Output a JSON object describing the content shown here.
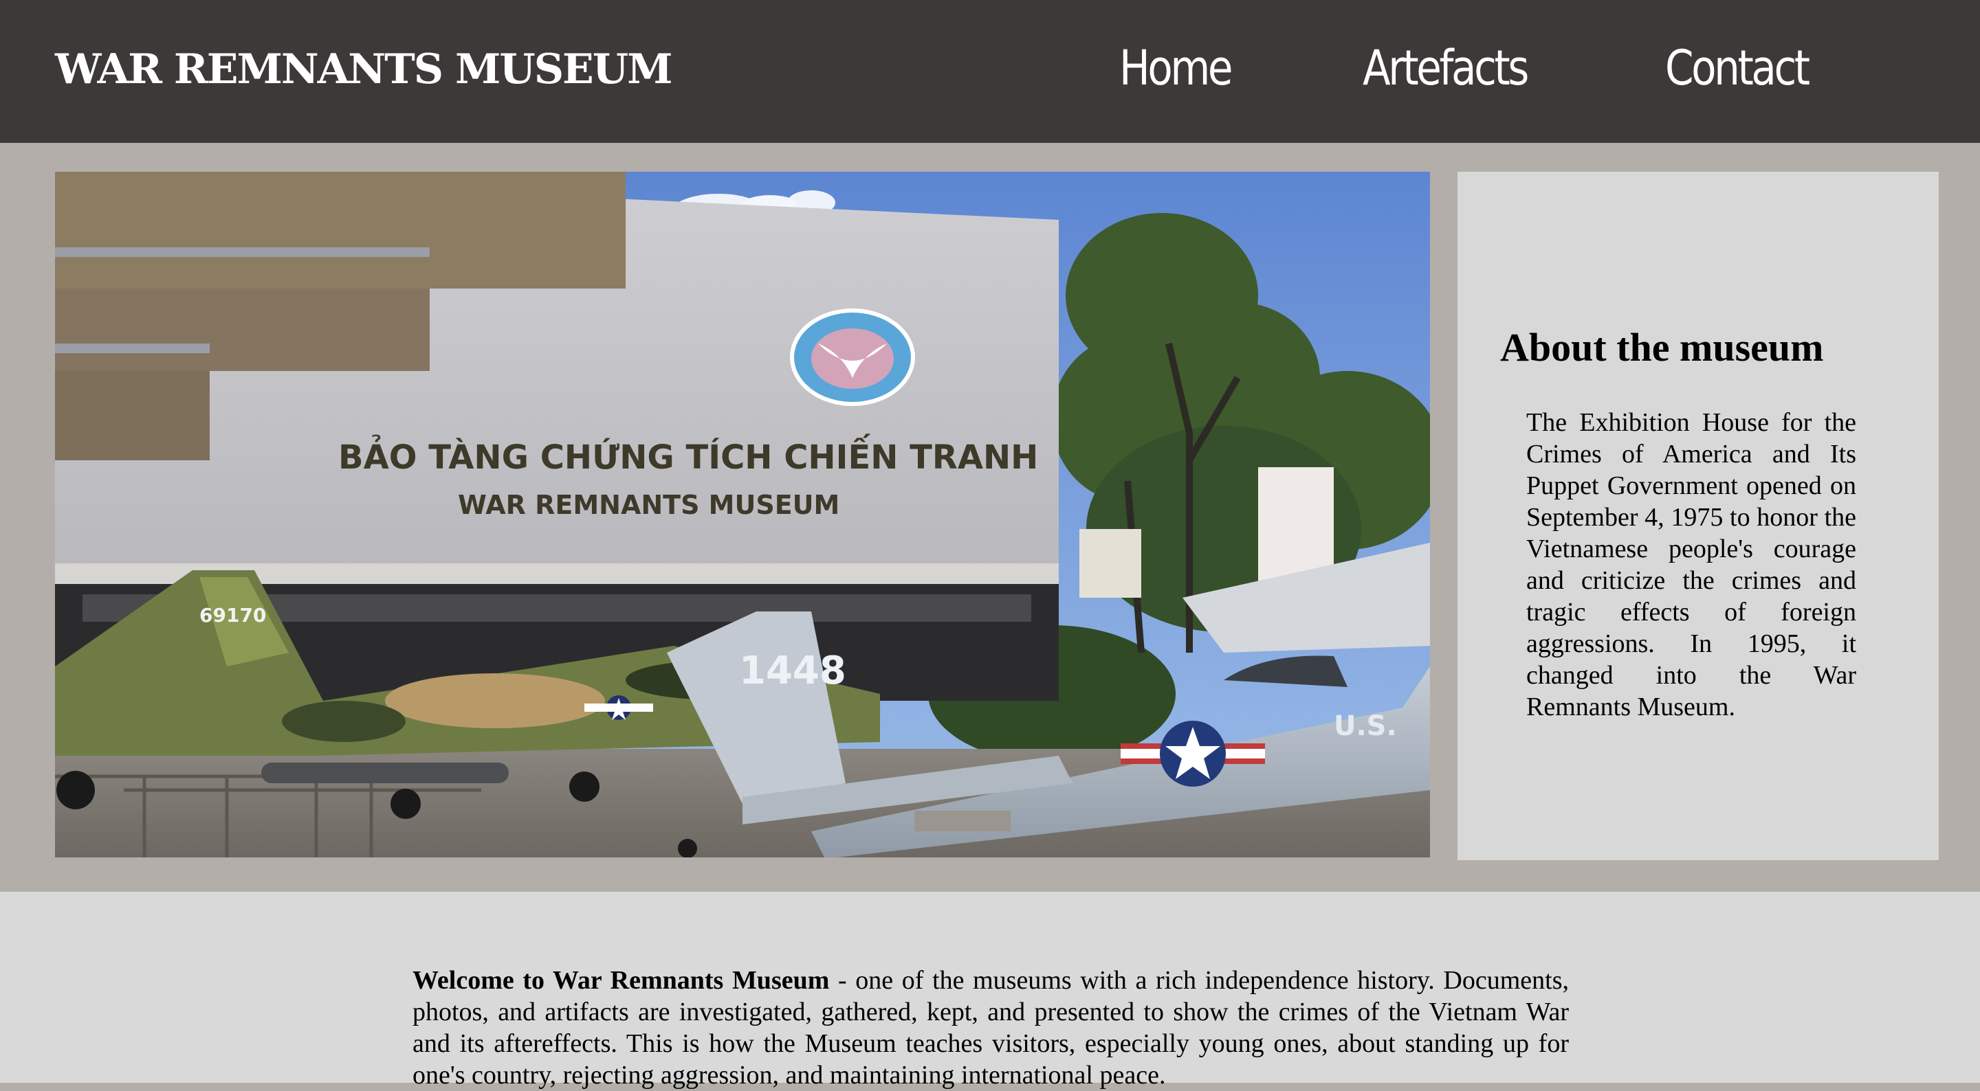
{
  "header": {
    "title": "WAR REMNANTS MUSEUM",
    "nav": [
      {
        "label": "Home"
      },
      {
        "label": "Artefacts"
      },
      {
        "label": "Contact"
      }
    ]
  },
  "hero": {
    "building_sign_line1": "BẢO TÀNG CHỨNG TÍCH CHIẾN TRANH",
    "building_sign_line2": "WAR REMNANTS MUSEUM",
    "aircraft_tail_1": "69170",
    "aircraft_tail_2": "1448",
    "aircraft_marking": "U.S."
  },
  "about": {
    "heading": "About the museum",
    "text": "The Exhibition House for the Crimes of America and Its Puppet Government opened on September 4, 1975 to honor the Vietnamese people's courage and criticize the crimes and tragic effects of foreign aggressions. In 1995, it changed into the War Remnants Museum."
  },
  "welcome": {
    "lead": "Welcome to War Remnants Museum",
    "text": " - one of the museums with a rich independence history. Documents, photos, and artifacts are investigated, gathered, kept, and presented to show the crimes of the Vietnam War and its aftereffects. This is how the Museum teaches visitors, especially young ones, about standing up for one's country, rejecting aggression, and maintaining international peace."
  },
  "colors": {
    "header_bg": "#3c3938",
    "page_bg": "#b3aea9",
    "panel_bg": "#d8d8d8"
  }
}
